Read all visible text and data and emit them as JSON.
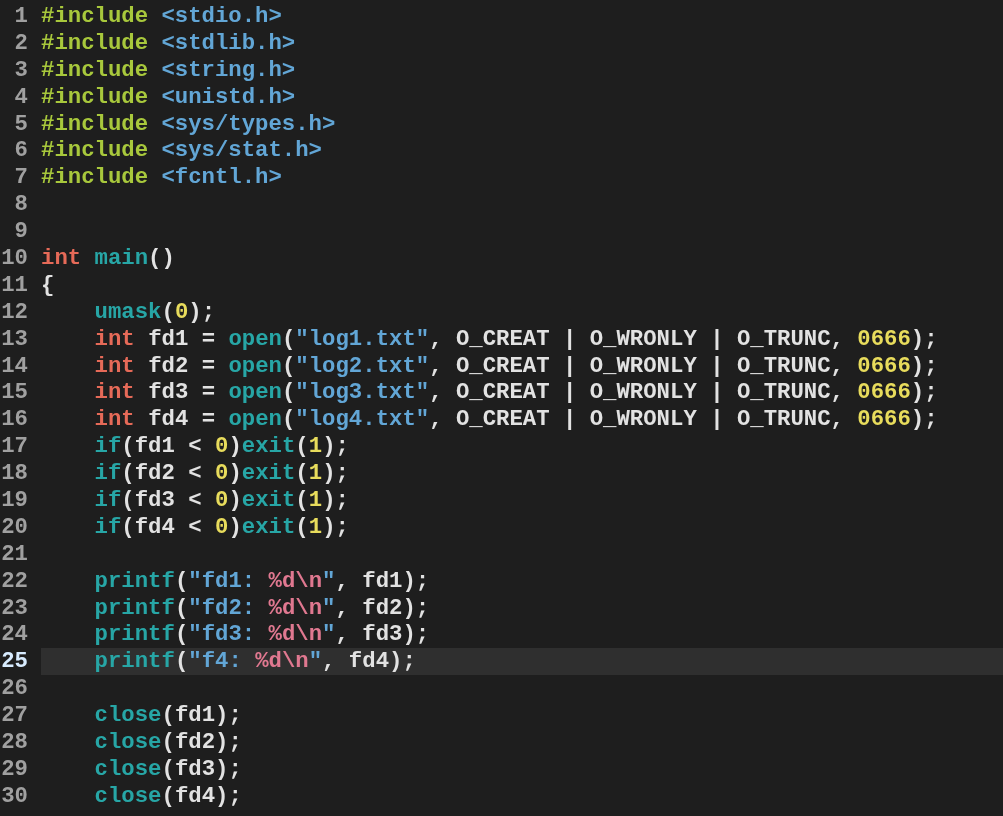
{
  "editor": {
    "lines": [
      {
        "number": "1",
        "current": false,
        "indented": false,
        "tokens": [
          {
            "kind": "p",
            "text": "#include "
          },
          {
            "kind": "h",
            "text": "<stdio.h>"
          }
        ]
      },
      {
        "number": "2",
        "current": false,
        "indented": false,
        "tokens": [
          {
            "kind": "p",
            "text": "#include "
          },
          {
            "kind": "h",
            "text": "<stdlib.h>"
          }
        ]
      },
      {
        "number": "3",
        "current": false,
        "indented": false,
        "tokens": [
          {
            "kind": "p",
            "text": "#include "
          },
          {
            "kind": "h",
            "text": "<string.h>"
          }
        ]
      },
      {
        "number": "4",
        "current": false,
        "indented": false,
        "tokens": [
          {
            "kind": "p",
            "text": "#include "
          },
          {
            "kind": "h",
            "text": "<unistd.h>"
          }
        ]
      },
      {
        "number": "5",
        "current": false,
        "indented": false,
        "tokens": [
          {
            "kind": "p",
            "text": "#include "
          },
          {
            "kind": "h",
            "text": "<sys/types.h>"
          }
        ]
      },
      {
        "number": "6",
        "current": false,
        "indented": false,
        "tokens": [
          {
            "kind": "p",
            "text": "#include "
          },
          {
            "kind": "h",
            "text": "<sys/stat.h>"
          }
        ]
      },
      {
        "number": "7",
        "current": false,
        "indented": false,
        "tokens": [
          {
            "kind": "p",
            "text": "#include "
          },
          {
            "kind": "h",
            "text": "<fcntl.h>"
          }
        ]
      },
      {
        "number": "8",
        "current": false
      },
      {
        "number": "9",
        "current": false
      },
      {
        "number": "10",
        "current": false,
        "indented": false,
        "tokens": [
          {
            "kind": "k",
            "text": "int "
          },
          {
            "kind": "f",
            "text": "main"
          },
          {
            "kind": "t",
            "text": "()"
          }
        ]
      },
      {
        "number": "11",
        "current": false,
        "indented": false,
        "tokens": [
          {
            "kind": "t",
            "text": "{"
          }
        ]
      },
      {
        "number": "12",
        "current": false,
        "indented": true,
        "tokens": [
          {
            "kind": "f",
            "text": "umask"
          },
          {
            "kind": "t",
            "text": "("
          },
          {
            "kind": "n",
            "text": "0"
          },
          {
            "kind": "t",
            "text": ");"
          }
        ]
      },
      {
        "number": "13",
        "current": false,
        "indented": true,
        "tokens": [
          {
            "kind": "k",
            "text": "int"
          },
          {
            "kind": "t",
            "text": " fd1 = "
          },
          {
            "kind": "f",
            "text": "open"
          },
          {
            "kind": "t",
            "text": "("
          },
          {
            "kind": "s",
            "text": "\"log1.txt\""
          },
          {
            "kind": "t",
            "text": ", O_CREAT | O_WRONLY | O_TRUNC, "
          },
          {
            "kind": "n",
            "text": "0666"
          },
          {
            "kind": "t",
            "text": ");"
          }
        ]
      },
      {
        "number": "14",
        "current": false,
        "indented": true,
        "tokens": [
          {
            "kind": "k",
            "text": "int"
          },
          {
            "kind": "t",
            "text": " fd2 = "
          },
          {
            "kind": "f",
            "text": "open"
          },
          {
            "kind": "t",
            "text": "("
          },
          {
            "kind": "s",
            "text": "\"log2.txt\""
          },
          {
            "kind": "t",
            "text": ", O_CREAT | O_WRONLY | O_TRUNC, "
          },
          {
            "kind": "n",
            "text": "0666"
          },
          {
            "kind": "t",
            "text": ");"
          }
        ]
      },
      {
        "number": "15",
        "current": false,
        "indented": true,
        "tokens": [
          {
            "kind": "k",
            "text": "int"
          },
          {
            "kind": "t",
            "text": " fd3 = "
          },
          {
            "kind": "f",
            "text": "open"
          },
          {
            "kind": "t",
            "text": "("
          },
          {
            "kind": "s",
            "text": "\"log3.txt\""
          },
          {
            "kind": "t",
            "text": ", O_CREAT | O_WRONLY | O_TRUNC, "
          },
          {
            "kind": "n",
            "text": "0666"
          },
          {
            "kind": "t",
            "text": ");"
          }
        ]
      },
      {
        "number": "16",
        "current": false,
        "indented": true,
        "tokens": [
          {
            "kind": "k",
            "text": "int"
          },
          {
            "kind": "t",
            "text": " fd4 = "
          },
          {
            "kind": "f",
            "text": "open"
          },
          {
            "kind": "t",
            "text": "("
          },
          {
            "kind": "s",
            "text": "\"log4.txt\""
          },
          {
            "kind": "t",
            "text": ", O_CREAT | O_WRONLY | O_TRUNC, "
          },
          {
            "kind": "n",
            "text": "0666"
          },
          {
            "kind": "t",
            "text": ");"
          }
        ]
      },
      {
        "number": "17",
        "current": false,
        "indented": true,
        "tokens": [
          {
            "kind": "f",
            "text": "if"
          },
          {
            "kind": "t",
            "text": "(fd1 < "
          },
          {
            "kind": "n",
            "text": "0"
          },
          {
            "kind": "t",
            "text": ")"
          },
          {
            "kind": "f",
            "text": "exit"
          },
          {
            "kind": "t",
            "text": "("
          },
          {
            "kind": "n",
            "text": "1"
          },
          {
            "kind": "t",
            "text": ");"
          }
        ]
      },
      {
        "number": "18",
        "current": false,
        "indented": true,
        "tokens": [
          {
            "kind": "f",
            "text": "if"
          },
          {
            "kind": "t",
            "text": "(fd2 < "
          },
          {
            "kind": "n",
            "text": "0"
          },
          {
            "kind": "t",
            "text": ")"
          },
          {
            "kind": "f",
            "text": "exit"
          },
          {
            "kind": "t",
            "text": "("
          },
          {
            "kind": "n",
            "text": "1"
          },
          {
            "kind": "t",
            "text": ");"
          }
        ]
      },
      {
        "number": "19",
        "current": false,
        "indented": true,
        "tokens": [
          {
            "kind": "f",
            "text": "if"
          },
          {
            "kind": "t",
            "text": "(fd3 < "
          },
          {
            "kind": "n",
            "text": "0"
          },
          {
            "kind": "t",
            "text": ")"
          },
          {
            "kind": "f",
            "text": "exit"
          },
          {
            "kind": "t",
            "text": "("
          },
          {
            "kind": "n",
            "text": "1"
          },
          {
            "kind": "t",
            "text": ");"
          }
        ]
      },
      {
        "number": "20",
        "current": false,
        "indented": true,
        "tokens": [
          {
            "kind": "f",
            "text": "if"
          },
          {
            "kind": "t",
            "text": "(fd4 < "
          },
          {
            "kind": "n",
            "text": "0"
          },
          {
            "kind": "t",
            "text": ")"
          },
          {
            "kind": "f",
            "text": "exit"
          },
          {
            "kind": "t",
            "text": "("
          },
          {
            "kind": "n",
            "text": "1"
          },
          {
            "kind": "t",
            "text": ");"
          }
        ]
      },
      {
        "number": "21",
        "current": false
      },
      {
        "number": "22",
        "current": false,
        "indented": true,
        "tokens": [
          {
            "kind": "f",
            "text": "printf"
          },
          {
            "kind": "t",
            "text": "("
          },
          {
            "kind": "s",
            "text": "\"fd1: "
          },
          {
            "kind": "e",
            "text": "%d\\n"
          },
          {
            "kind": "s",
            "text": "\""
          },
          {
            "kind": "t",
            "text": ", fd1);"
          }
        ]
      },
      {
        "number": "23",
        "current": false,
        "indented": true,
        "tokens": [
          {
            "kind": "f",
            "text": "printf"
          },
          {
            "kind": "t",
            "text": "("
          },
          {
            "kind": "s",
            "text": "\"fd2: "
          },
          {
            "kind": "e",
            "text": "%d\\n"
          },
          {
            "kind": "s",
            "text": "\""
          },
          {
            "kind": "t",
            "text": ", fd2);"
          }
        ]
      },
      {
        "number": "24",
        "current": false,
        "indented": true,
        "tokens": [
          {
            "kind": "f",
            "text": "printf"
          },
          {
            "kind": "t",
            "text": "("
          },
          {
            "kind": "s",
            "text": "\"fd3: "
          },
          {
            "kind": "e",
            "text": "%d\\n"
          },
          {
            "kind": "s",
            "text": "\""
          },
          {
            "kind": "t",
            "text": ", fd3);"
          }
        ]
      },
      {
        "number": "25",
        "current": true,
        "indented": true,
        "tokens": [
          {
            "kind": "f",
            "text": "printf"
          },
          {
            "kind": "t",
            "text": "("
          },
          {
            "kind": "s",
            "text": "\"f4: "
          },
          {
            "kind": "e",
            "text": "%d\\n"
          },
          {
            "kind": "s",
            "text": "\""
          },
          {
            "kind": "t",
            "text": ", fd4);"
          }
        ]
      },
      {
        "number": "26",
        "current": false
      },
      {
        "number": "27",
        "current": false,
        "indented": true,
        "tokens": [
          {
            "kind": "f",
            "text": "close"
          },
          {
            "kind": "t",
            "text": "(fd1);"
          }
        ]
      },
      {
        "number": "28",
        "current": false,
        "indented": true,
        "tokens": [
          {
            "kind": "f",
            "text": "close"
          },
          {
            "kind": "t",
            "text": "(fd2);"
          }
        ]
      },
      {
        "number": "29",
        "current": false,
        "indented": true,
        "tokens": [
          {
            "kind": "f",
            "text": "close"
          },
          {
            "kind": "t",
            "text": "(fd3);"
          }
        ]
      },
      {
        "number": "30",
        "current": false,
        "indented": true,
        "tokens": [
          {
            "kind": "f",
            "text": "close"
          },
          {
            "kind": "t",
            "text": "(fd4);"
          }
        ]
      }
    ]
  }
}
